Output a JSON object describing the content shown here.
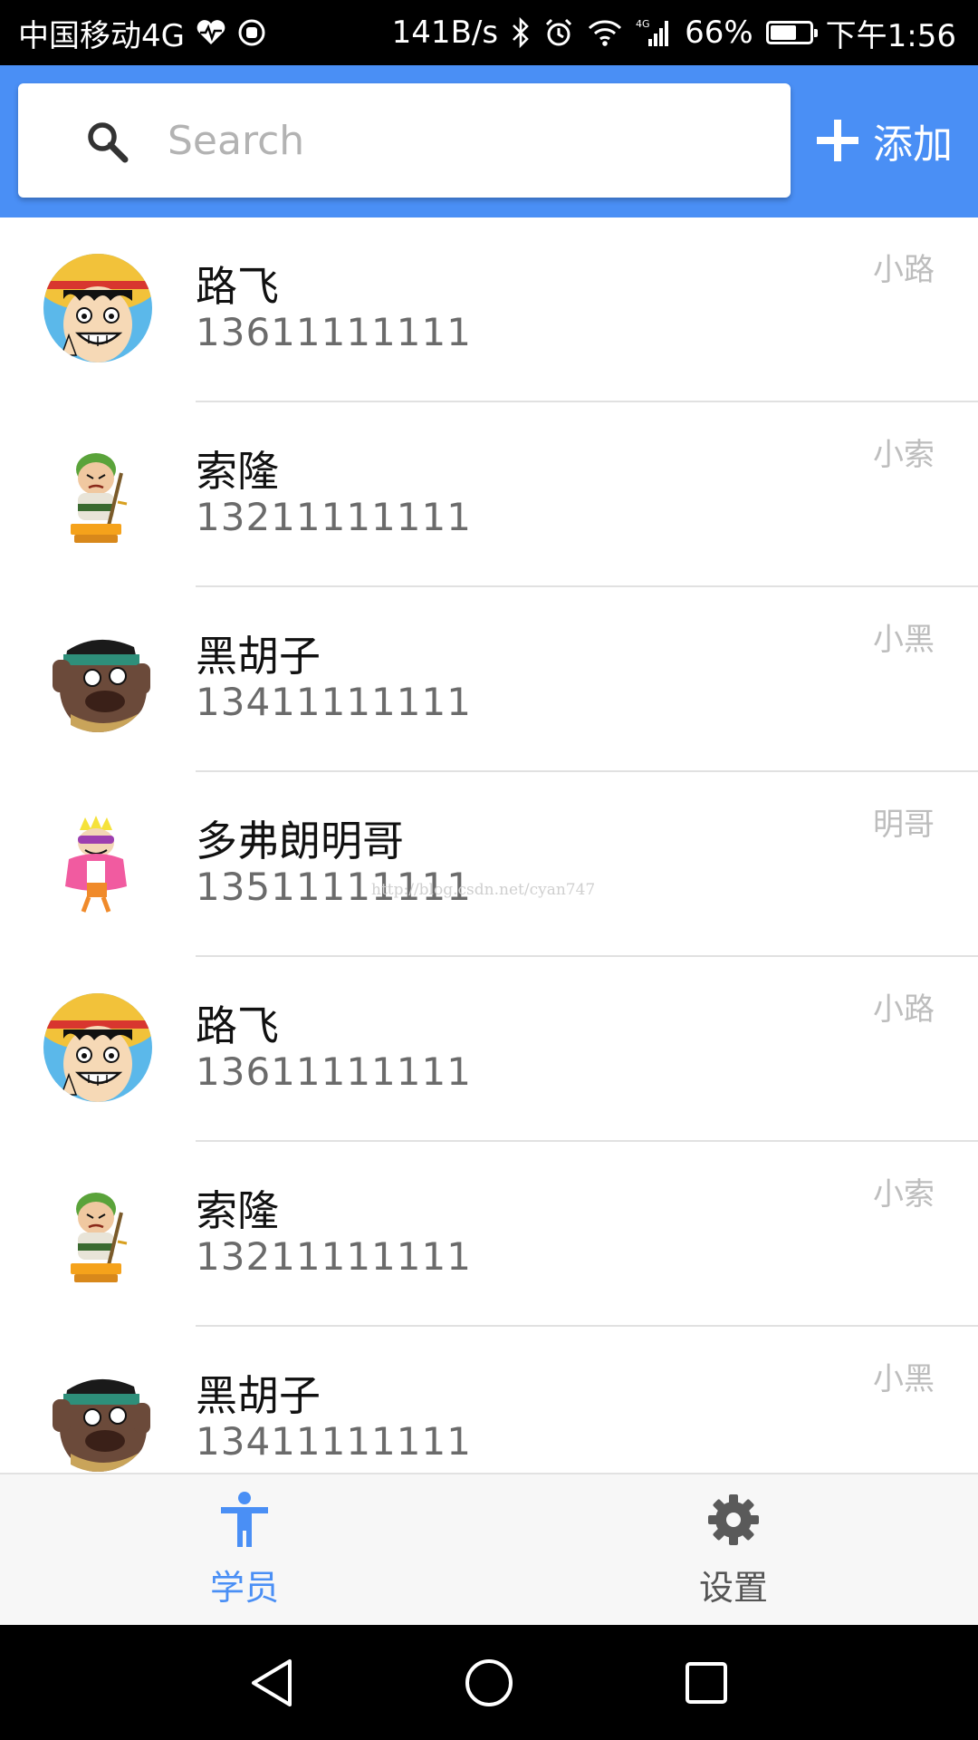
{
  "status_bar": {
    "carrier": "中国移动4G",
    "net_speed": "141B/s",
    "signal_label": "4G",
    "battery": "66%",
    "battery_level": 0.66,
    "time": "下午1:56"
  },
  "app_bar": {
    "search_placeholder": "Search",
    "search_value": "",
    "add_label": "添加",
    "background_color": "#4a8ff5"
  },
  "contacts": [
    {
      "name": "路飞",
      "phone": "13611111111",
      "nickname": "小路",
      "avatar_icon": "luffy-avatar-icon"
    },
    {
      "name": "索隆",
      "phone": "13211111111",
      "nickname": "小索",
      "avatar_icon": "zoro-avatar-icon"
    },
    {
      "name": "黑胡子",
      "phone": "13411111111",
      "nickname": "小黑",
      "avatar_icon": "blackbeard-avatar-icon"
    },
    {
      "name": "多弗朗明哥",
      "phone": "13511111111",
      "nickname": "明哥",
      "avatar_icon": "doflamingo-avatar-icon"
    },
    {
      "name": "路飞",
      "phone": "13611111111",
      "nickname": "小路",
      "avatar_icon": "luffy-avatar-icon"
    },
    {
      "name": "索隆",
      "phone": "13211111111",
      "nickname": "小索",
      "avatar_icon": "zoro-avatar-icon"
    },
    {
      "name": "黑胡子",
      "phone": "13411111111",
      "nickname": "小黑",
      "avatar_icon": "blackbeard-avatar-icon"
    }
  ],
  "watermark": "http://blog.csdn.net/cyan747",
  "bottom_nav": {
    "tabs": [
      {
        "label": "学员",
        "icon": "person-icon",
        "active": true
      },
      {
        "label": "设置",
        "icon": "gear-icon",
        "active": false
      }
    ],
    "active_color": "#4a8ff5",
    "inactive_color": "#555555"
  },
  "system_nav": {
    "buttons": [
      "back-icon",
      "home-icon",
      "recents-icon"
    ]
  }
}
